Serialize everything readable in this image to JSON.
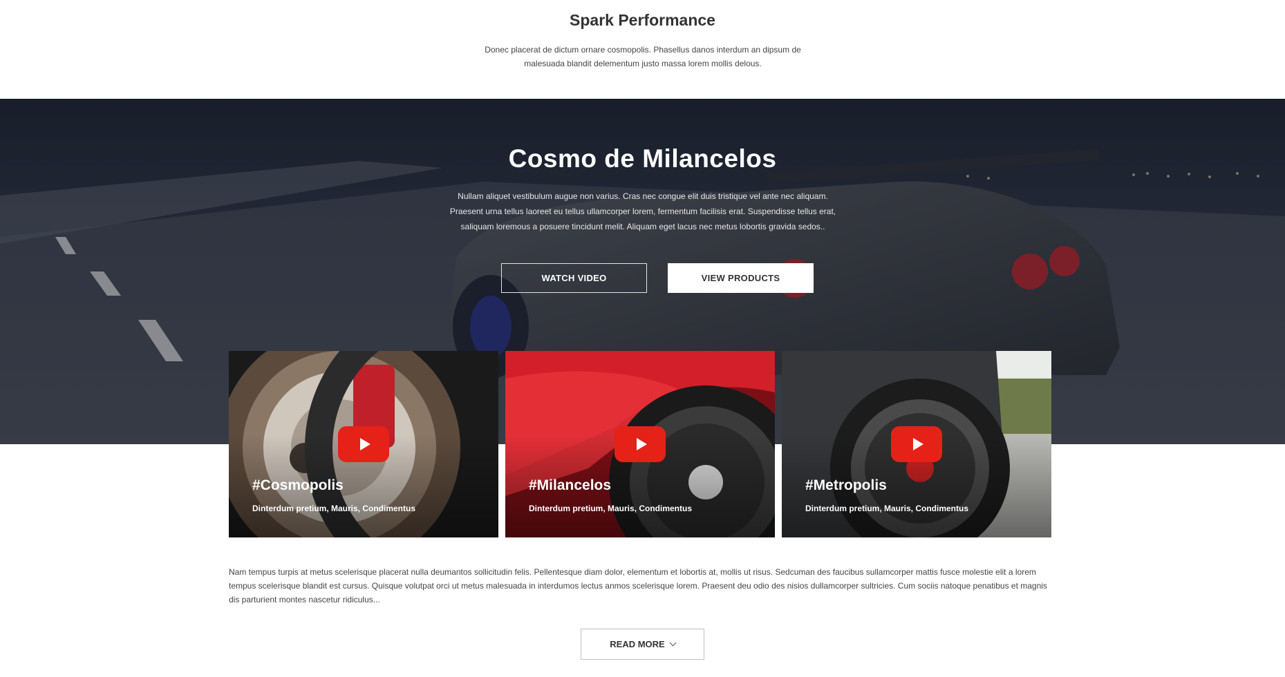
{
  "intro": {
    "title": "Spark Performance",
    "text": "Donec placerat de dictum ornare cosmopolis. Phasellus danos interdum an dipsum de malesuada blandit delementum justo massa lorem mollis delous."
  },
  "hero": {
    "title": "Cosmo de Milancelos",
    "text": "Nullam aliquet vestibulum augue non varius. Cras nec congue elit duis tristique vel ante nec aliquam. Praesent urna tellus laoreet eu tellus ullamcorper lorem, fermentum facilisis erat. Suspendisse tellus erat, saliquam loremous a posuere tincidunt melit. Aliquam eget lacus nec metus lobortis gravida sedos..",
    "watch_label": "WATCH VIDEO",
    "products_label": "VIEW PRODUCTS"
  },
  "cards": [
    {
      "tag": "#Cosmopolis",
      "sub": "Dinterdum pretium, Mauris, Condimentus"
    },
    {
      "tag": "#Milancelos",
      "sub": "Dinterdum pretium, Mauris, Condimentus"
    },
    {
      "tag": "#Metropolis",
      "sub": "Dinterdum pretium, Mauris, Condimentus"
    }
  ],
  "body_text": "Nam tempus turpis at metus scelerisque placerat nulla deumantos sollicitudin felis. Pellentesque diam dolor, elementum et lobortis at, mollis ut risus. Sedcuman des faucibus sullamcorper mattis fusce molestie elit a lorem tempus scelerisque blandit est cursus. Quisque volutpat orci ut metus malesuada in interdumos lectus anmos scelerisque lorem. Praesent deu odio des nisios dullamcorper sultricies. Cum sociis natoque penatibus et magnis dis parturient montes nascetur ridiculus...",
  "read_more_label": "READ MORE",
  "colors": {
    "play": "#e62117",
    "text": "#333333"
  },
  "icons": {
    "play": "play-icon",
    "chevron": "chevron-down-icon"
  }
}
